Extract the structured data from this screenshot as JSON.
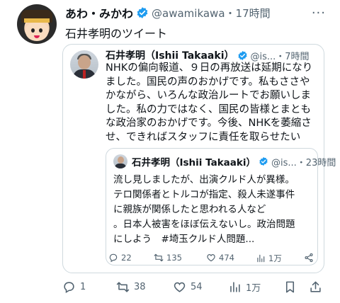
{
  "post": {
    "author_name": "あわ・みかわ",
    "handle_time": "@awamikawa・17時間",
    "more_label": "···",
    "text": "石井孝明のツイート"
  },
  "quoted": {
    "author_name": "石井孝明（Ishii Takaaki）",
    "handle_time": "@is...・7時間",
    "lines": [
      "NHKの偏向報道、９日の再放送は延期になり",
      "ました。国民の声のおかげです。私もささや",
      "かながら、いろんな政治ルートでお願いしま",
      "した。私の力ではなく、国民の皆様とまとも",
      "な政治家のおかげです。今後、NHKを萎縮さ",
      "せ、できればスタッフに責任を取らせたい"
    ],
    "nested": {
      "author_name": "石井孝明（Ishii Takaaki）",
      "handle_time": "@is...・23時間",
      "lines": [
        "流し見しましたが、出演クルド人が異様。",
        "テロ関係者とトルコが指定、殺人未遂事件",
        "に親族が関係したと思われる人など",
        "。日本人被害をほぼ伝えないし。政治問題",
        "にしよう　#埼玉クルド人問題..."
      ]
    },
    "actions": {
      "replies": "22",
      "reposts": "135",
      "likes": "474",
      "views": "1万"
    }
  },
  "actions": {
    "replies": "1",
    "reposts": "38",
    "likes": "54",
    "views": "1万"
  },
  "colors": {
    "verified": "#1d9bf0",
    "muted": "#536471",
    "border": "#cfd9de"
  }
}
